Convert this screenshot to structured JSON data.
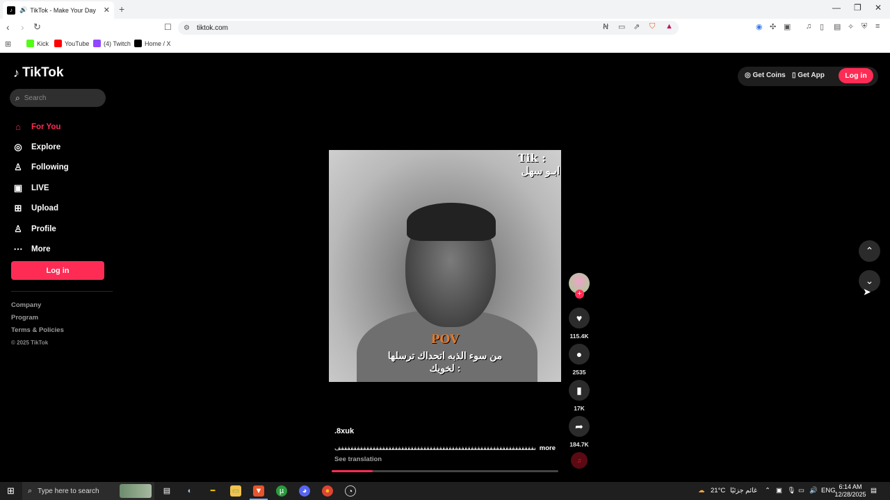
{
  "browser": {
    "tab_title": "TikTok - Make Your Day",
    "new_tab": "+",
    "url": "tiktok.com",
    "bookmarks": [
      {
        "label": "Kick",
        "color": "#53fc18"
      },
      {
        "label": "YouTube",
        "color": "#ff0000"
      },
      {
        "label": "(4) Twitch",
        "color": "#9146ff"
      },
      {
        "label": "Home / X",
        "color": "#000000"
      }
    ],
    "window_controls": [
      "—",
      "❐",
      "✕"
    ]
  },
  "tiktok": {
    "brand": "TikTok",
    "search_placeholder": "Search",
    "nav": [
      {
        "label": "For You",
        "icon": "home-icon",
        "active": true
      },
      {
        "label": "Explore",
        "icon": "compass-icon"
      },
      {
        "label": "Following",
        "icon": "following-icon"
      },
      {
        "label": "LIVE",
        "icon": "live-icon"
      },
      {
        "label": "Upload",
        "icon": "upload-icon"
      },
      {
        "label": "Profile",
        "icon": "profile-icon"
      },
      {
        "label": "More",
        "icon": "more-icon"
      }
    ],
    "sidebar_login": "Log in",
    "footer": [
      "Company",
      "Program",
      "Terms & Policies"
    ],
    "copyright": "© 2025 TikTok",
    "header": {
      "get_coins": "Get Coins",
      "get_app": "Get App",
      "login": "Log in"
    },
    "accent_color": "#fe2c55"
  },
  "video": {
    "overlay_tik": "Tik :",
    "overlay_name": "ابـو سهل",
    "overlay_pov": "POV",
    "overlay_caption_1": "من سوء الذبه اتحداك ترسلها",
    "overlay_caption_2": "لخويك :",
    "author": ".8xuk",
    "description": "ففففففففففففففففففففففففففففففففففففففففففففففففففففففففففففففففففففففففففففففففففف",
    "more": "more",
    "see_translation": "See translation",
    "progress": 0.18,
    "likes": "115.4K",
    "comments": "2535",
    "saves": "17K",
    "shares": "184.7K"
  },
  "taskbar": {
    "search_placeholder": "Type here to search",
    "weather": "21°C",
    "weather_text": "غائم جزئيًا",
    "language": "ENG",
    "time": "6:14 AM",
    "date": "12/28/2025"
  }
}
